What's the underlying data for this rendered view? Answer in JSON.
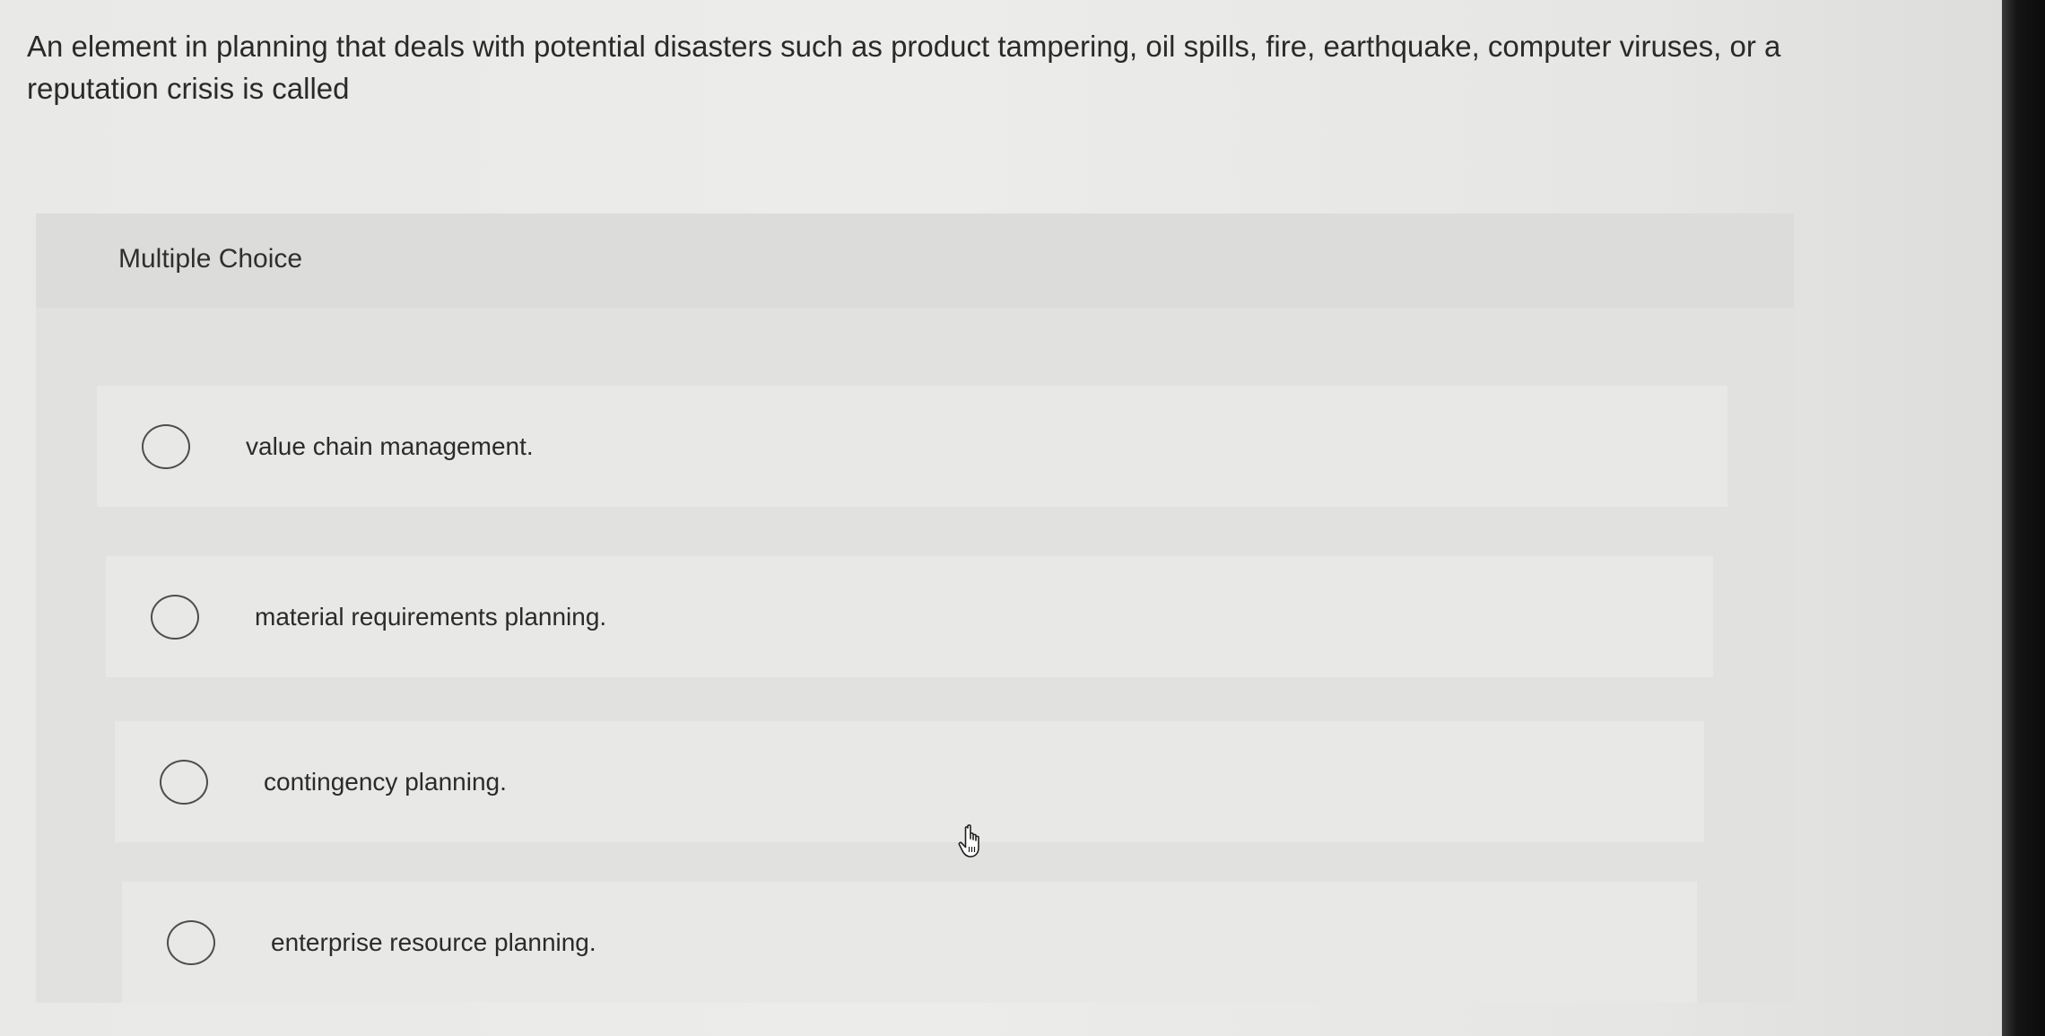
{
  "question": {
    "text": "An element in planning that deals with potential disasters such as product tampering, oil spills, fire, earthquake, computer viruses, or a reputation crisis is called"
  },
  "multiple_choice": {
    "heading": "Multiple Choice",
    "options": [
      {
        "label": "value chain management.",
        "selected": false
      },
      {
        "label": "material requirements planning.",
        "selected": false
      },
      {
        "label": "contingency planning.",
        "selected": false
      },
      {
        "label": "enterprise resource planning.",
        "selected": false
      }
    ]
  },
  "icons": {
    "radio": "radio-button-icon",
    "cursor": "hand-pointer-icon"
  }
}
